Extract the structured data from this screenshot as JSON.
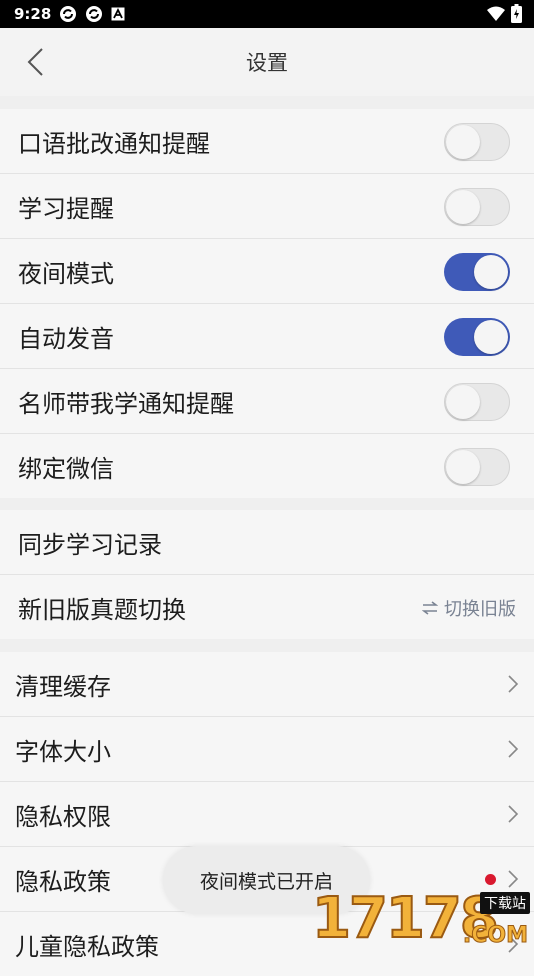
{
  "status_bar": {
    "time": "9:28",
    "notification_icons": [
      "sync-icon",
      "sync-icon",
      "a-icon"
    ],
    "right_icons": [
      "wifi-icon",
      "battery-icon"
    ]
  },
  "header": {
    "title": "设置"
  },
  "toggles": [
    {
      "label": "口语批改通知提醒",
      "on": false
    },
    {
      "label": "学习提醒",
      "on": false
    },
    {
      "label": "夜间模式",
      "on": true
    },
    {
      "label": "自动发音",
      "on": true
    },
    {
      "label": "名师带我学通知提醒",
      "on": false
    },
    {
      "label": "绑定微信",
      "on": false
    }
  ],
  "sync": {
    "label": "同步学习记录"
  },
  "version": {
    "label": "新旧版真题切换",
    "action": "切换旧版"
  },
  "menu": [
    {
      "label": "清理缓存"
    },
    {
      "label": "字体大小"
    },
    {
      "label": "隐私权限"
    },
    {
      "label": "隐私政策"
    },
    {
      "label": "儿童隐私政策"
    }
  ],
  "toast": {
    "text": "夜间模式已开启"
  },
  "watermark": {
    "number": "17178",
    "tag": "下载站",
    "suffix": ".COM"
  },
  "colors": {
    "toggle_on": "#3f5ab8",
    "red_dot": "#d9192f"
  }
}
